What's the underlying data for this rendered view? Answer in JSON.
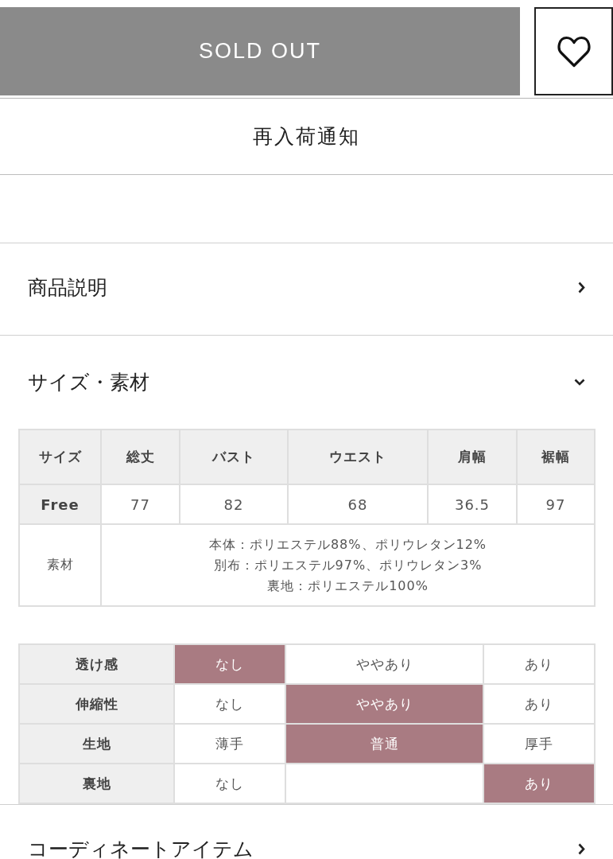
{
  "sold_out_button": {
    "label": "SOLD OUT",
    "disabled": true
  },
  "restock_button": {
    "label": "再入荷通知"
  },
  "sections": [
    {
      "title": "商品説明",
      "expanded": false
    },
    {
      "title": "サイズ・素材",
      "expanded": true,
      "size_table": {
        "columns": [
          "サイズ",
          "総丈",
          "バスト",
          "ウエスト",
          "肩幅",
          "裾幅"
        ],
        "rows": [
          {
            "cells": [
              "Free",
              "77",
              "82",
              "68",
              "36.5",
              "97"
            ]
          }
        ],
        "material": {
          "label": "素材",
          "lines": [
            "本体：ポリエステル88%、ポリウレタン12%",
            "別布：ポリエステル97%、ポリウレタン3%",
            "裏地：ポリエステル100%"
          ]
        }
      },
      "feel_table": {
        "rows": [
          {
            "label": "透け感",
            "options": [
              {
                "label": "なし",
                "selected": true
              },
              {
                "label": "ややあり",
                "selected": false
              },
              {
                "label": "あり",
                "selected": false
              }
            ]
          },
          {
            "label": "伸縮性",
            "options": [
              {
                "label": "なし",
                "selected": false
              },
              {
                "label": "ややあり",
                "selected": true
              },
              {
                "label": "あり",
                "selected": false
              }
            ]
          },
          {
            "label": "生地",
            "options": [
              {
                "label": "薄手",
                "selected": false
              },
              {
                "label": "普通",
                "selected": true
              },
              {
                "label": "厚手",
                "selected": false
              }
            ]
          },
          {
            "label": "裏地",
            "options": [
              {
                "label": "なし",
                "selected": false
              },
              {
                "selected": false
              },
              {
                "label": "あり",
                "selected": true
              }
            ]
          }
        ]
      }
    },
    {
      "title": "コーディネートアイテム",
      "expanded": false
    }
  ]
}
